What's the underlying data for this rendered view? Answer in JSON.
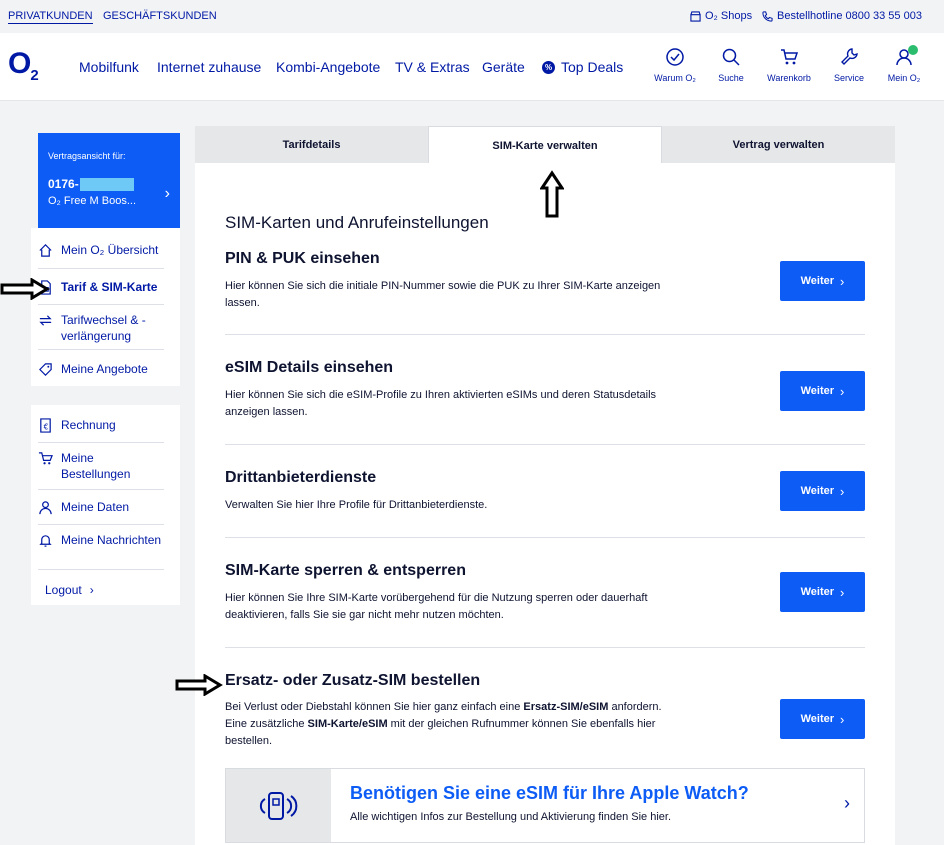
{
  "topbar": {
    "privat": "PRIVATKUNDEN",
    "geschaeft": "GESCHÄFTSKUNDEN",
    "shops": "O₂ Shops",
    "hotline": "Bestellhotline 0800 33 55 003"
  },
  "header": {
    "logo": "O",
    "logo_sub": "2",
    "nav": [
      "Mobilfunk",
      "Internet zuhause",
      "Kombi-Angebote",
      "TV & Extras",
      "Geräte"
    ],
    "top_deals": "Top Deals",
    "icons": {
      "warum": "Warum O₂",
      "suche": "Suche",
      "warenkorb": "Warenkorb",
      "service": "Service",
      "mein": "Mein O₂"
    }
  },
  "contract": {
    "label": "Vertragsansicht für:",
    "number": "0176-",
    "plan": "O₂ Free M Boos..."
  },
  "sidebar": {
    "group1": [
      "Mein O₂ Übersicht",
      "Tarif & SIM-Karte",
      "Tarifwechsel & -verlängerung",
      "Meine Angebote"
    ],
    "group2": [
      "Rechnung",
      "Meine Bestellungen",
      "Meine Daten",
      "Meine Nachrichten"
    ],
    "logout": "Logout"
  },
  "tabs": [
    "Tarifdetails",
    "SIM-Karte verwalten",
    "Vertrag verwalten"
  ],
  "content": {
    "section_title": "SIM-Karten und Anrufeinstellungen",
    "button_label": "Weiter",
    "items": [
      {
        "title": "PIN & PUK einsehen",
        "desc": "Hier können Sie sich die initiale PIN-Nummer sowie die PUK zu Ihrer SIM-Karte anzeigen lassen."
      },
      {
        "title": "eSIM Details einsehen",
        "desc": "Hier können Sie sich die eSIM-Profile zu Ihren aktivierten eSIMs und deren Statusdetails anzeigen lassen."
      },
      {
        "title": "Drittanbieterdienste",
        "desc": "Verwalten Sie hier Ihre Profile für Drittanbieterdienste."
      },
      {
        "title": "SIM-Karte sperren & entsperren",
        "desc": "Hier können Sie Ihre SIM-Karte vorübergehend für die Nutzung sperren oder dauerhaft deaktivieren, falls Sie sie gar nicht mehr nutzen möchten."
      },
      {
        "title": "Ersatz- oder Zusatz-SIM bestellen",
        "desc1a": "Bei Verlust oder Diebstahl können Sie hier ganz einfach eine ",
        "desc1b": "Ersatz-SIM/eSIM",
        "desc1c": " anfordern.",
        "desc2a": "Eine zusätzliche ",
        "desc2b": "SIM-Karte/eSIM",
        "desc2c": " mit der gleichen Rufnummer können Sie ebenfalls hier bestellen."
      }
    ],
    "banner": {
      "title": "Benötigen Sie eine eSIM für Ihre Apple Watch?",
      "subtitle": "Alle wichtigen Infos zur Bestellung und Aktivierung finden Sie hier."
    }
  },
  "colors": {
    "brand": "#0019a5",
    "accent": "#0d5cf5",
    "masked": "#6ec9f7"
  }
}
